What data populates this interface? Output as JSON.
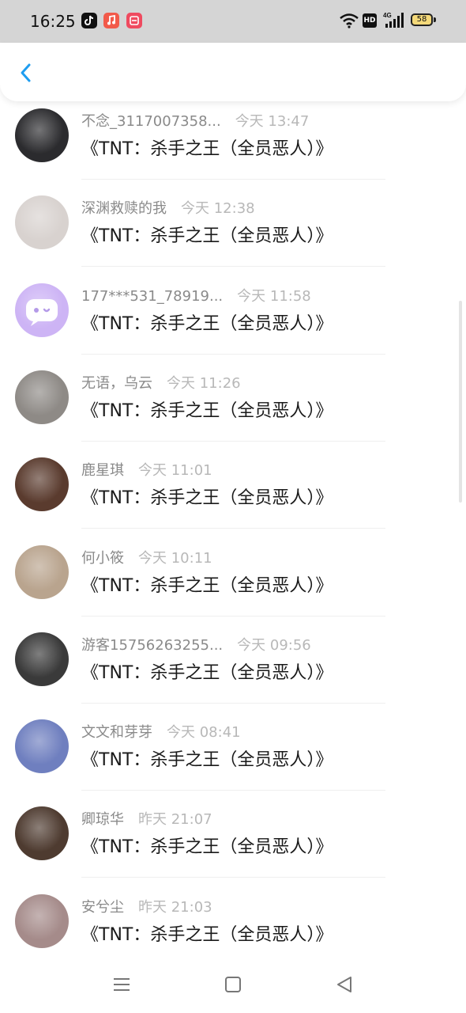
{
  "status_bar": {
    "time": "16:25",
    "apps": [
      "tiktok-icon",
      "music-icon",
      "red-app-icon"
    ],
    "hd": "HD",
    "network": "4G",
    "battery": "58"
  },
  "header": {
    "back_icon": "chevron-left-icon",
    "accent": "#1e9df0"
  },
  "items": [
    {
      "name": "不念_3117007358...",
      "time": "今天 13:47",
      "title": "《TNT：杀手之王（全员恶人）》",
      "avatar_color": "#2b2b2e"
    },
    {
      "name": "深渊救赎的我",
      "time": "今天 12:38",
      "title": "《TNT：杀手之王（全员恶人）》",
      "avatar_color": "#d8d2cf"
    },
    {
      "name": "177***531_78919...",
      "time": "今天 11:58",
      "title": "《TNT：杀手之王（全员恶人）》",
      "avatar_color": "#cdb4f5"
    },
    {
      "name": "无语，乌云",
      "time": "今天 11:26",
      "title": "《TNT：杀手之王（全员恶人）》",
      "avatar_color": "#8e8a86"
    },
    {
      "name": "鹿星琪",
      "time": "今天 11:01",
      "title": "《TNT：杀手之王（全员恶人）》",
      "avatar_color": "#5a3b2e"
    },
    {
      "name": "何小筱",
      "time": "今天 10:11",
      "title": "《TNT：杀手之王（全员恶人）》",
      "avatar_color": "#b9a48e"
    },
    {
      "name": "游客15756263255...",
      "time": "今天 09:56",
      "title": "《TNT：杀手之王（全员恶人）》",
      "avatar_color": "#3a3a3a"
    },
    {
      "name": "文文和芽芽",
      "time": "今天 08:41",
      "title": "《TNT：杀手之王（全员恶人）》",
      "avatar_color": "#6f7fbf"
    },
    {
      "name": "卿琼华",
      "time": "昨天 21:07",
      "title": "《TNT：杀手之王（全员恶人）》",
      "avatar_color": "#4e3b30"
    },
    {
      "name": "安兮尘",
      "time": "昨天 21:03",
      "title": "《TNT：杀手之王（全员恶人）》",
      "avatar_color": "#a58b8a"
    }
  ],
  "bottom_nav": [
    "menu-icon",
    "home-square-icon",
    "back-triangle-icon"
  ]
}
